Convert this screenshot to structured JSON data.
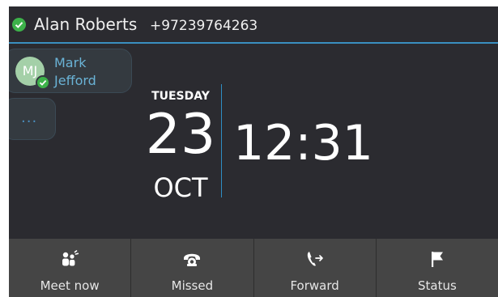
{
  "header": {
    "user_name": "Alan Roberts",
    "user_number": "+97239764263",
    "presence": "available"
  },
  "contacts": {
    "favorite": {
      "initials": "MJ",
      "name_line1": "Mark",
      "name_line2": "Jefford",
      "presence": "available"
    },
    "more_label": "..."
  },
  "datetime": {
    "weekday": "TUESDAY",
    "day": "23",
    "month": "OCT",
    "time": "12:31"
  },
  "softkeys": [
    {
      "label": "Meet now",
      "icon": "people-icon"
    },
    {
      "label": "Missed",
      "icon": "phone-hangup-icon"
    },
    {
      "label": "Forward",
      "icon": "forward-call-icon"
    },
    {
      "label": "Status",
      "icon": "flag-icon"
    }
  ],
  "colors": {
    "background": "#2b2b30",
    "accent": "#3a8fc0",
    "presence_green": "#3db24a",
    "softkey_bg": "#454545",
    "contact_name": "#6ab3d6"
  }
}
